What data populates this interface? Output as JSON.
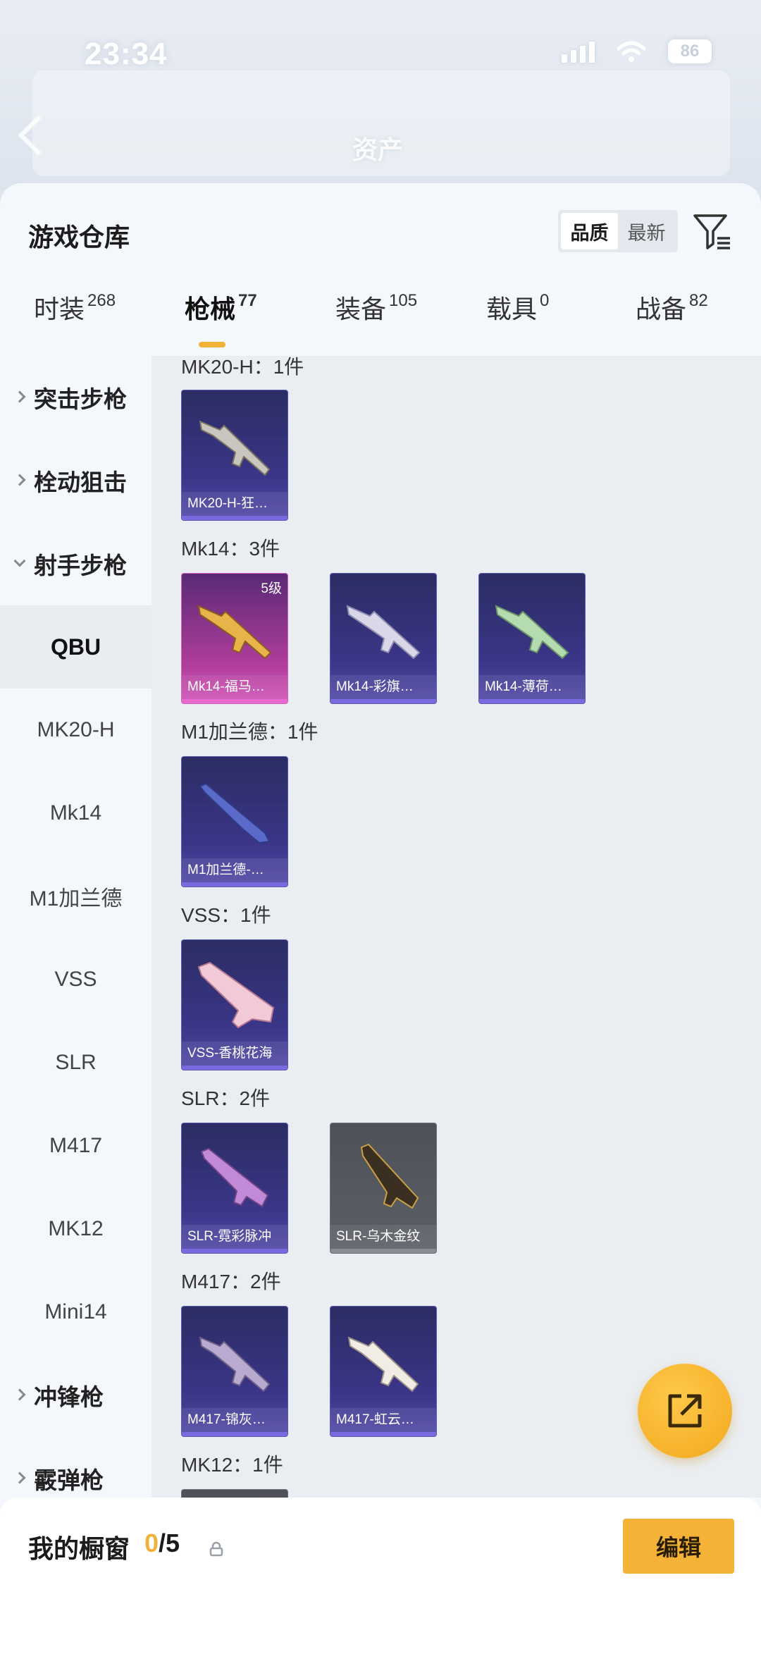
{
  "status_bar": {
    "time": "23:34",
    "battery": "86"
  },
  "header": {
    "back_label": "",
    "title_blur": "资产"
  },
  "panel": {
    "title": "游戏仓库",
    "sort": {
      "options": [
        "品质",
        "最新"
      ],
      "active": "品质"
    }
  },
  "tabs": [
    {
      "label": "时装",
      "count": "268"
    },
    {
      "label": "枪械",
      "count": "77",
      "active": true
    },
    {
      "label": "装备",
      "count": "105"
    },
    {
      "label": "载具",
      "count": "0"
    },
    {
      "label": "战备",
      "count": "82"
    }
  ],
  "sidebar": [
    {
      "label": "突击步枪",
      "type": "category",
      "expanded": false
    },
    {
      "label": "栓动狙击",
      "type": "category",
      "expanded": false
    },
    {
      "label": "射手步枪",
      "type": "category",
      "expanded": true
    },
    {
      "label": "QBU",
      "type": "sub",
      "selected": true
    },
    {
      "label": "MK20-H",
      "type": "sub"
    },
    {
      "label": "Mk14",
      "type": "sub"
    },
    {
      "label": "M1加兰德",
      "type": "sub"
    },
    {
      "label": "VSS",
      "type": "sub"
    },
    {
      "label": "SLR",
      "type": "sub"
    },
    {
      "label": "M417",
      "type": "sub"
    },
    {
      "label": "MK12",
      "type": "sub"
    },
    {
      "label": "Mini14",
      "type": "sub"
    },
    {
      "label": "冲锋枪",
      "type": "category",
      "expanded": false
    },
    {
      "label": "霰弹枪",
      "type": "category",
      "expanded": false
    }
  ],
  "groups": [
    {
      "title": "MK20-H：1件",
      "items": [
        {
          "name": "MK20-H-狂…",
          "rarity": "purple"
        }
      ]
    },
    {
      "title": "Mk14：3件",
      "items": [
        {
          "name": "Mk14-福马…",
          "rarity": "pink",
          "level": "5级"
        },
        {
          "name": "Mk14-彩旗…",
          "rarity": "purple"
        },
        {
          "name": "Mk14-薄荷…",
          "rarity": "purple"
        }
      ]
    },
    {
      "title": "M1加兰德：1件",
      "items": [
        {
          "name": "M1加兰德-…",
          "rarity": "purple"
        }
      ]
    },
    {
      "title": "VSS：1件",
      "items": [
        {
          "name": "VSS-香桃花海",
          "rarity": "purple"
        }
      ]
    },
    {
      "title": "SLR：2件",
      "items": [
        {
          "name": "SLR-霓彩脉冲",
          "rarity": "purple"
        },
        {
          "name": "SLR-乌木金纹",
          "rarity": "grey"
        }
      ]
    },
    {
      "title": "M417：2件",
      "items": [
        {
          "name": "M417-锦灰…",
          "rarity": "purple"
        },
        {
          "name": "M417-虹云…",
          "rarity": "purple"
        }
      ]
    },
    {
      "title": "MK12：1件",
      "items": []
    }
  ],
  "showcase": {
    "title": "我的橱窗",
    "current": "0",
    "total": "/5",
    "edit_label": "编辑"
  },
  "colors": {
    "accent": "#f4b337",
    "purple_card": "#3a3587",
    "pink_card": "#b03d9b"
  }
}
